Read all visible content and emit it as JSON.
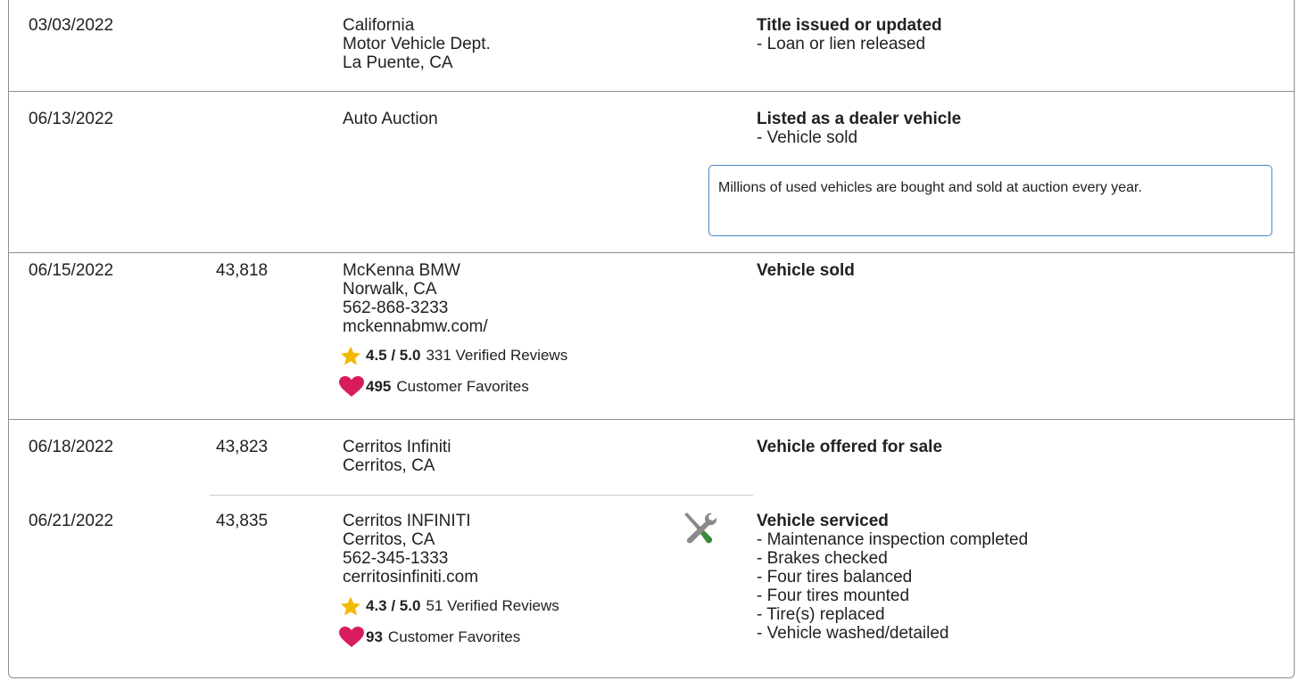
{
  "records": [
    {
      "date": "03/03/2022",
      "mileage": "",
      "source": [
        "California",
        "Motor Vehicle Dept.",
        "La Puente, CA"
      ],
      "comment_title": "Title issued or updated",
      "comment_items": [
        "- Loan or lien released"
      ]
    },
    {
      "date": "06/13/2022",
      "mileage": "",
      "source": [
        "Auto Auction"
      ],
      "comment_title": "Listed as a dealer vehicle",
      "comment_items": [
        "- Vehicle sold"
      ],
      "note": "Millions of used vehicles are bought and sold at auction every year."
    },
    {
      "date": "06/15/2022",
      "mileage": "43,818",
      "source": [
        "McKenna BMW",
        "Norwalk, CA",
        "562-868-3233",
        "mckennabmw.com/"
      ],
      "rating": {
        "score": "4.5 / 5.0",
        "reviews": "331 Verified Reviews"
      },
      "favorites": {
        "count": "495",
        "label": "Customer Favorites"
      },
      "comment_title": "Vehicle sold",
      "comment_items": []
    },
    {
      "date": "06/18/2022",
      "mileage": "43,823",
      "source": [
        "Cerritos Infiniti",
        "Cerritos, CA"
      ],
      "comment_title": "Vehicle offered for sale",
      "comment_items": []
    },
    {
      "date": "06/21/2022",
      "mileage": "43,835",
      "source": [
        "Cerritos INFINITI",
        "Cerritos, CA",
        "562-345-1333",
        "cerritosinfiniti.com"
      ],
      "rating": {
        "score": "4.3 / 5.0",
        "reviews": "51 Verified Reviews"
      },
      "favorites": {
        "count": "93",
        "label": "Customer Favorites"
      },
      "icon": "service-tools-icon",
      "comment_title": "Vehicle serviced",
      "comment_items": [
        "- Maintenance inspection completed",
        "- Brakes checked",
        "- Four tires balanced",
        "- Four tires mounted",
        "- Tire(s) replaced",
        "- Vehicle washed/detailed"
      ]
    }
  ],
  "colors": {
    "border": "#8e8e8e",
    "note_border": "#4a86c8",
    "star": "#f5b800",
    "heart": "#d81b5e",
    "tool_gray": "#8a8a8a",
    "tool_green": "#3c8a3c"
  }
}
